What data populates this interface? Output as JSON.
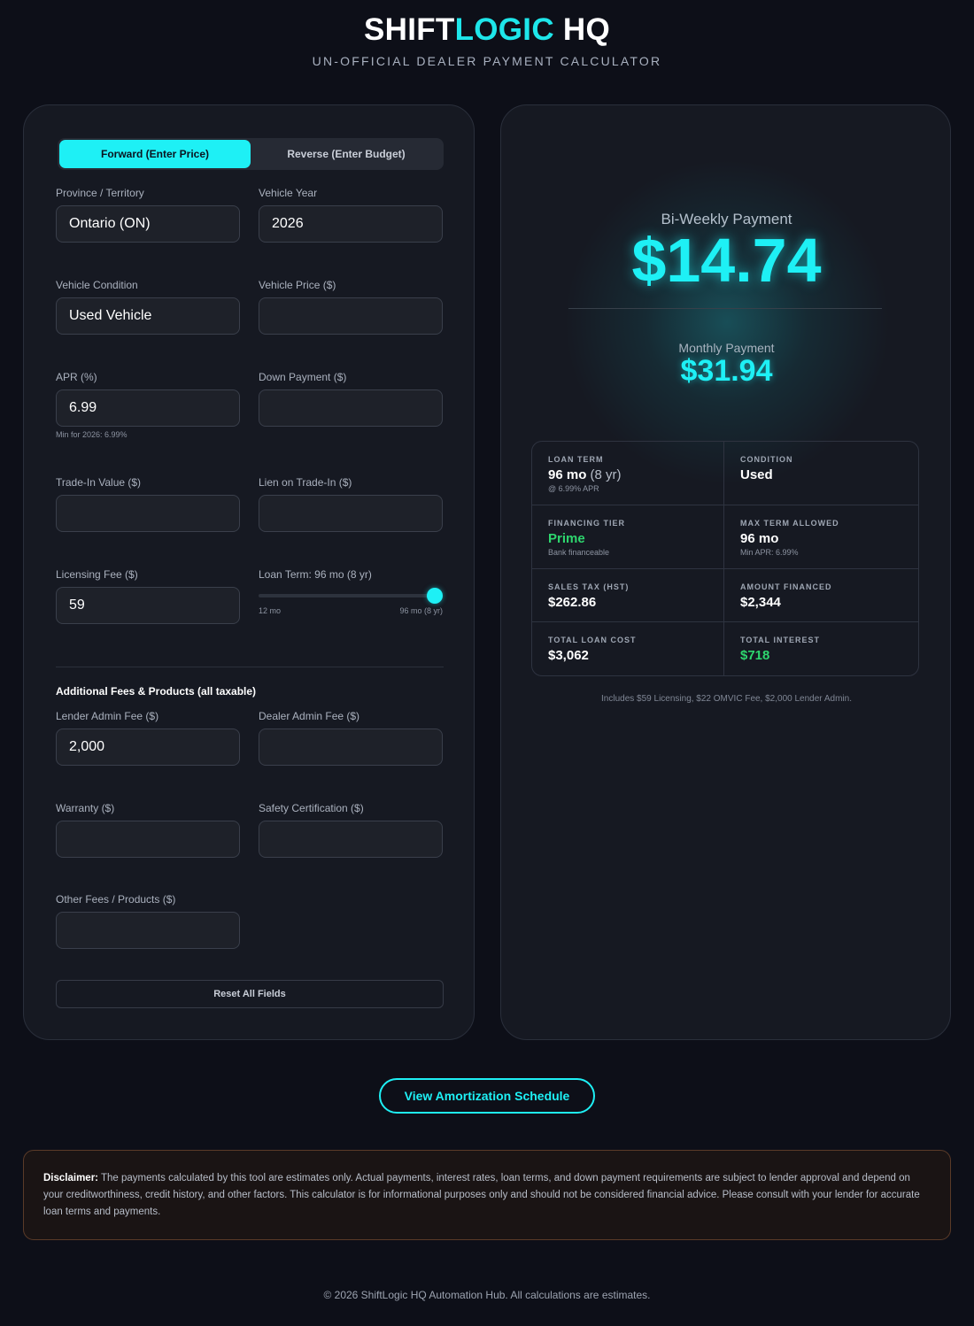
{
  "header": {
    "brand_part1": "SHIFT",
    "brand_part2": "LOGIC",
    "brand_part3": " HQ",
    "subtitle": "UN-OFFICIAL DEALER PAYMENT CALCULATOR"
  },
  "mode": {
    "forward_label": "Forward (Enter Price)",
    "reverse_label": "Reverse (Enter Budget)",
    "active": "forward"
  },
  "form": {
    "province": {
      "label": "Province / Territory",
      "value": "Ontario (ON)"
    },
    "year": {
      "label": "Vehicle Year",
      "value": "2026"
    },
    "condition": {
      "label": "Vehicle Condition",
      "value": "Used Vehicle"
    },
    "price": {
      "label": "Vehicle Price ($)",
      "value": ""
    },
    "apr": {
      "label": "APR (%)",
      "value": "6.99",
      "hint": "Min for 2026: 6.99%"
    },
    "down": {
      "label": "Down Payment ($)",
      "value": ""
    },
    "tradein": {
      "label": "Trade-In Value ($)",
      "value": ""
    },
    "lien": {
      "label": "Lien on Trade-In ($)",
      "value": ""
    },
    "licensing": {
      "label": "Licensing Fee ($)",
      "value": "59"
    },
    "loan_term": {
      "label": "Loan Term: 96 mo (8 yr)",
      "min_label": "12 mo",
      "max_label": "96 mo (8 yr)",
      "value_months": 96,
      "min_months": 12,
      "max_months": 96
    },
    "section_title": "Additional Fees & Products (all taxable)",
    "lender_admin": {
      "label": "Lender Admin Fee ($)",
      "value": "2,000"
    },
    "dealer_admin": {
      "label": "Dealer Admin Fee ($)",
      "value": ""
    },
    "warranty": {
      "label": "Warranty ($)",
      "value": ""
    },
    "safety": {
      "label": "Safety Certification ($)",
      "value": ""
    },
    "other": {
      "label": "Other Fees / Products ($)",
      "value": ""
    },
    "reset_label": "Reset All Fields"
  },
  "results": {
    "biweekly_label": "Bi-Weekly Payment",
    "biweekly_amount": "$14.74",
    "monthly_label": "Monthly Payment",
    "monthly_amount": "$31.94",
    "stats": {
      "loan_term": {
        "label": "LOAN TERM",
        "value": "96 mo",
        "value_extra": " (8 yr)",
        "sub": "@ 6.99% APR"
      },
      "condition": {
        "label": "CONDITION",
        "value": "Used"
      },
      "tier": {
        "label": "FINANCING TIER",
        "value": "Prime",
        "sub": "Bank financeable"
      },
      "max_term": {
        "label": "MAX TERM ALLOWED",
        "value": "96 mo",
        "sub": "Min APR: 6.99%"
      },
      "sales_tax": {
        "label": "SALES TAX (HST)",
        "value": "$262.86"
      },
      "amount_financed": {
        "label": "AMOUNT FINANCED",
        "value": "$2,344"
      },
      "total_cost": {
        "label": "TOTAL LOAN COST",
        "value": "$3,062"
      },
      "total_interest": {
        "label": "TOTAL INTEREST",
        "value": "$718"
      }
    },
    "footnote": "Includes $59 Licensing, $22 OMVIC Fee, $2,000 Lender Admin."
  },
  "amortization_button": "View Amortization Schedule",
  "disclaimer": {
    "title": "Disclaimer:",
    "text": " The payments calculated by this tool are estimates only. Actual payments, interest rates, loan terms, and down payment requirements are subject to lender approval and depend on your creditworthiness, credit history, and other factors. This calculator is for informational purposes only and should not be considered financial advice. Please consult with your lender for accurate loan terms and payments."
  },
  "footer": "© 2026 ShiftLogic HQ Automation Hub. All calculations are estimates.",
  "colors": {
    "accent": "#1ef0f5",
    "success": "#2ed66e",
    "background": "#0d0f18",
    "panel": "#161922"
  }
}
